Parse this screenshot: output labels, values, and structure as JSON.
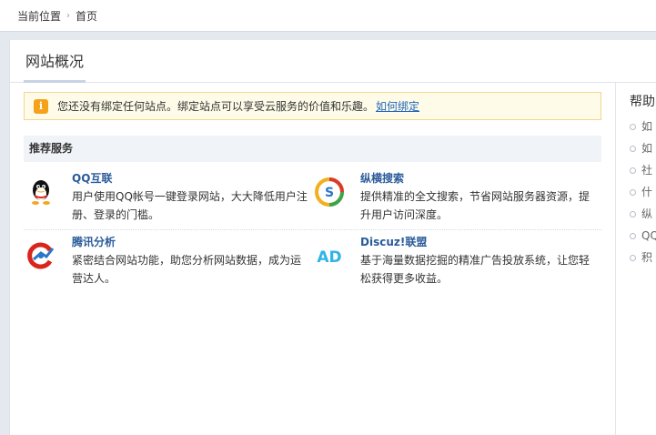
{
  "breadcrumb": {
    "label": "当前位置",
    "separator": "›",
    "current": "首页"
  },
  "tabs": {
    "active": "网站概况"
  },
  "notice": {
    "icon": "info-icon",
    "text": "您还没有绑定任何站点。绑定站点可以享受云服务的价值和乐趣。",
    "link": "如何绑定"
  },
  "services": {
    "heading": "推荐服务",
    "items": [
      {
        "title": "QQ互联",
        "desc": "用户使用QQ帐号一键登录网站，大大降低用户注册、登录的门槛。",
        "icon": "qq-penguin-icon"
      },
      {
        "title": "纵横搜索",
        "desc": "提供精准的全文搜索，节省网站服务器资源，提升用户访问深度。",
        "icon": "search-s-icon"
      },
      {
        "title": "腾讯分析",
        "desc": "紧密结合网站功能，助您分析网站数据，成为运营达人。",
        "icon": "analytics-icon"
      },
      {
        "title": "Discuz!联盟",
        "desc": "基于海量数据挖掘的精准广告投放系统，让您轻松获得更多收益。",
        "icon": "ad-icon"
      }
    ]
  },
  "help": {
    "title": "帮助",
    "items": [
      "如",
      "如",
      "社",
      "什",
      "纵",
      "QQ",
      "积"
    ]
  },
  "colors": {
    "accent_link": "#2266bb",
    "service_title": "#2a5a9a",
    "notice_bg": "#fefce8",
    "notice_border": "#f1d78f"
  }
}
